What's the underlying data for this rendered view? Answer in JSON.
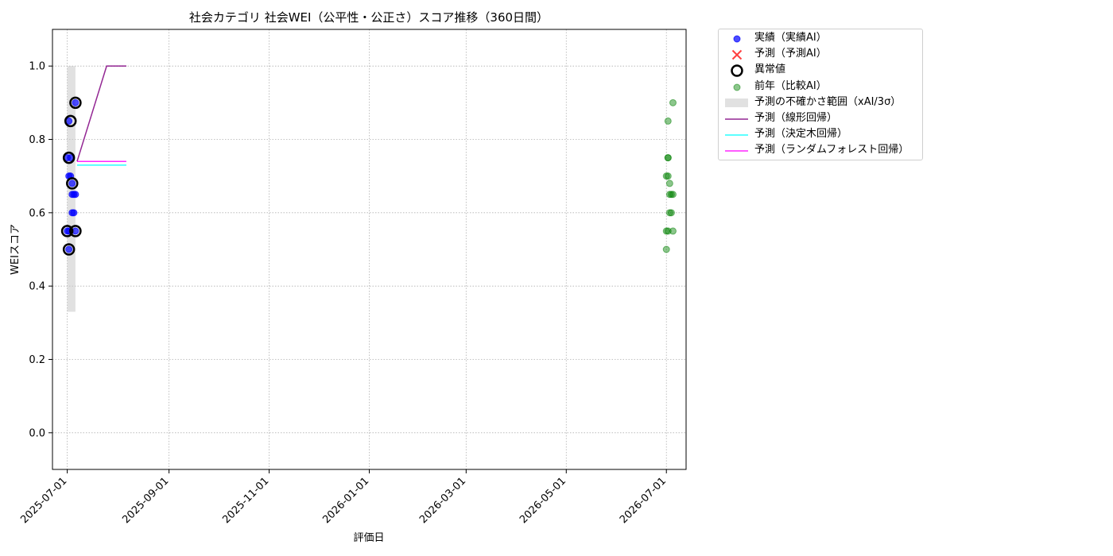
{
  "chart_data": {
    "type": "scatter",
    "title": "社会カテゴリ 社会WEI（公平性・公正さ）スコア推移（360日間）",
    "xlabel": "評価日",
    "ylabel": "WEIスコア",
    "xlim": [
      "2025-06-22",
      "2026-07-13"
    ],
    "ylim": [
      -0.1,
      1.1
    ],
    "x_ticks": [
      "2025-07-01",
      "2025-09-01",
      "2025-11-01",
      "2026-01-01",
      "2026-03-01",
      "2026-05-01",
      "2026-07-01"
    ],
    "y_ticks": [
      "0.0",
      "0.2",
      "0.4",
      "0.6",
      "0.8",
      "1.0"
    ],
    "grid": true,
    "legend_position": "outside-upper-right",
    "colors": {
      "actual": "#0000ff",
      "forecast_marker": "#ff0000",
      "anomaly": "#000000",
      "previous_year": "#008000",
      "uncertainty": "#c8c8c8",
      "linear": "#800080",
      "tree": "#00ffff",
      "forest": "#ff00ff"
    },
    "legend": [
      {
        "key": "actual",
        "label": "実績（実績AI）",
        "marker": "dot"
      },
      {
        "key": "forecast",
        "label": "予測（予測AI）",
        "marker": "x"
      },
      {
        "key": "anomaly",
        "label": "異常値",
        "marker": "ring"
      },
      {
        "key": "previous_year",
        "label": "前年（比較AI）",
        "marker": "dot-faint"
      },
      {
        "key": "uncertainty",
        "label": "予測の不確かさ範囲（xAI/3σ）",
        "marker": "band"
      },
      {
        "key": "linear",
        "label": "予測（線形回帰）",
        "marker": "line"
      },
      {
        "key": "tree",
        "label": "予測（決定木回帰）",
        "marker": "line"
      },
      {
        "key": "forest",
        "label": "予測（ランダムフォレスト回帰）",
        "marker": "line"
      }
    ],
    "series": [
      {
        "key": "actual",
        "kind": "scatter",
        "points": [
          {
            "x": "2025-07-01",
            "y": 0.55
          },
          {
            "x": "2025-07-01",
            "y": 0.75
          },
          {
            "x": "2025-07-02",
            "y": 0.7
          },
          {
            "x": "2025-07-02",
            "y": 0.5
          },
          {
            "x": "2025-07-02",
            "y": 0.55
          },
          {
            "x": "2025-07-02",
            "y": 0.85
          },
          {
            "x": "2025-07-03",
            "y": 0.75
          },
          {
            "x": "2025-07-03",
            "y": 0.7
          },
          {
            "x": "2025-07-04",
            "y": 0.65
          },
          {
            "x": "2025-07-04",
            "y": 0.68
          },
          {
            "x": "2025-07-04",
            "y": 0.6
          },
          {
            "x": "2025-07-05",
            "y": 0.6
          },
          {
            "x": "2025-07-05",
            "y": 0.65
          },
          {
            "x": "2025-07-06",
            "y": 0.55
          },
          {
            "x": "2025-07-06",
            "y": 0.9
          },
          {
            "x": "2025-07-06",
            "y": 0.65
          }
        ]
      },
      {
        "key": "anomaly",
        "kind": "scatter",
        "points": [
          {
            "x": "2025-07-01",
            "y": 0.55
          },
          {
            "x": "2025-07-02",
            "y": 0.5
          },
          {
            "x": "2025-07-02",
            "y": 0.75
          },
          {
            "x": "2025-07-03",
            "y": 0.85
          },
          {
            "x": "2025-07-04",
            "y": 0.68
          },
          {
            "x": "2025-07-06",
            "y": 0.55
          },
          {
            "x": "2025-07-06",
            "y": 0.9
          }
        ]
      },
      {
        "key": "previous_year",
        "kind": "scatter",
        "points": [
          {
            "x": "2026-07-01",
            "y": 0.55
          },
          {
            "x": "2026-07-01",
            "y": 0.7
          },
          {
            "x": "2026-07-01",
            "y": 0.5
          },
          {
            "x": "2026-07-02",
            "y": 0.75
          },
          {
            "x": "2026-07-02",
            "y": 0.55
          },
          {
            "x": "2026-07-02",
            "y": 0.85
          },
          {
            "x": "2026-07-02",
            "y": 0.75
          },
          {
            "x": "2026-07-02",
            "y": 0.7
          },
          {
            "x": "2026-07-03",
            "y": 0.68
          },
          {
            "x": "2026-07-03",
            "y": 0.6
          },
          {
            "x": "2026-07-03",
            "y": 0.65
          },
          {
            "x": "2026-07-04",
            "y": 0.65
          },
          {
            "x": "2026-07-04",
            "y": 0.6
          },
          {
            "x": "2026-07-05",
            "y": 0.65
          },
          {
            "x": "2026-07-05",
            "y": 0.9
          },
          {
            "x": "2026-07-05",
            "y": 0.55
          }
        ]
      },
      {
        "key": "uncertainty",
        "kind": "band",
        "x_from": "2025-07-01",
        "x_to": "2025-07-06",
        "y_low": 0.33,
        "y_high": 1.0
      },
      {
        "key": "linear",
        "kind": "line",
        "points": [
          {
            "x": "2025-07-07",
            "y": 0.74
          },
          {
            "x": "2025-07-25",
            "y": 1.0
          },
          {
            "x": "2025-08-06",
            "y": 1.0
          }
        ]
      },
      {
        "key": "tree",
        "kind": "line",
        "points": [
          {
            "x": "2025-07-07",
            "y": 0.73
          },
          {
            "x": "2025-08-06",
            "y": 0.73
          }
        ]
      },
      {
        "key": "forest",
        "kind": "line",
        "points": [
          {
            "x": "2025-07-07",
            "y": 0.74
          },
          {
            "x": "2025-08-06",
            "y": 0.74
          }
        ]
      }
    ]
  }
}
